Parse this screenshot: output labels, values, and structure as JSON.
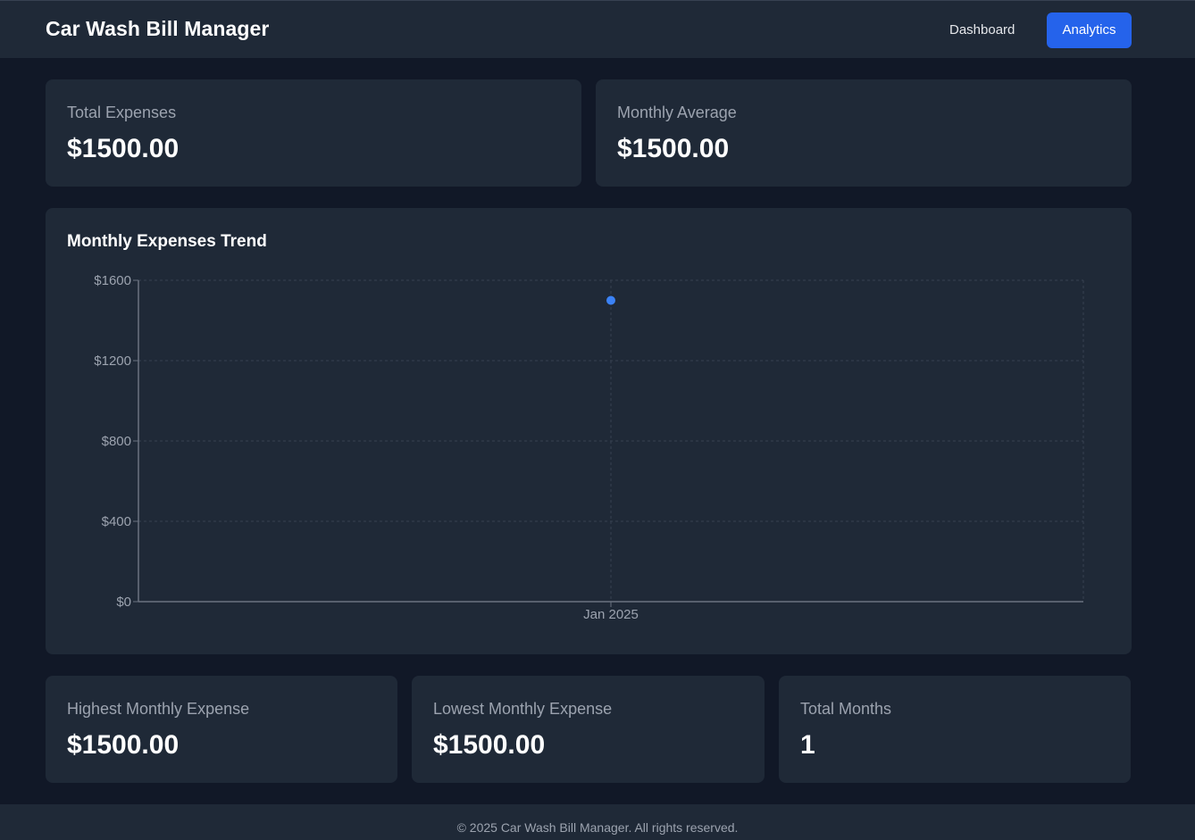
{
  "header": {
    "title": "Car Wash Bill Manager",
    "nav": {
      "dashboard": "Dashboard",
      "analytics": "Analytics"
    },
    "active_tab": "Analytics"
  },
  "summary": {
    "total_expenses": {
      "label": "Total Expenses",
      "value": "$1500.00"
    },
    "monthly_average": {
      "label": "Monthly Average",
      "value": "$1500.00"
    }
  },
  "stats": {
    "highest": {
      "label": "Highest Monthly Expense",
      "value": "$1500.00"
    },
    "lowest": {
      "label": "Lowest Monthly Expense",
      "value": "$1500.00"
    },
    "months": {
      "label": "Total Months",
      "value": "1"
    }
  },
  "chart_data": {
    "type": "line",
    "title": "Monthly Expenses Trend",
    "categories": [
      "Jan 2025"
    ],
    "series": [
      {
        "values": [
          1500
        ],
        "color": "#3b82f6"
      }
    ],
    "ylim": [
      0,
      1600
    ],
    "yticks": [
      0,
      400,
      800,
      1200,
      1600
    ],
    "ytick_labels": [
      "$0",
      "$400",
      "$800",
      "$1200",
      "$1600"
    ],
    "grid": true
  },
  "footer": {
    "text": "© 2025 Car Wash Bill Manager. All rights reserved."
  },
  "colors": {
    "accent": "#2563eb",
    "background": "#111827",
    "card": "#1f2937",
    "point": "#3b82f6"
  }
}
